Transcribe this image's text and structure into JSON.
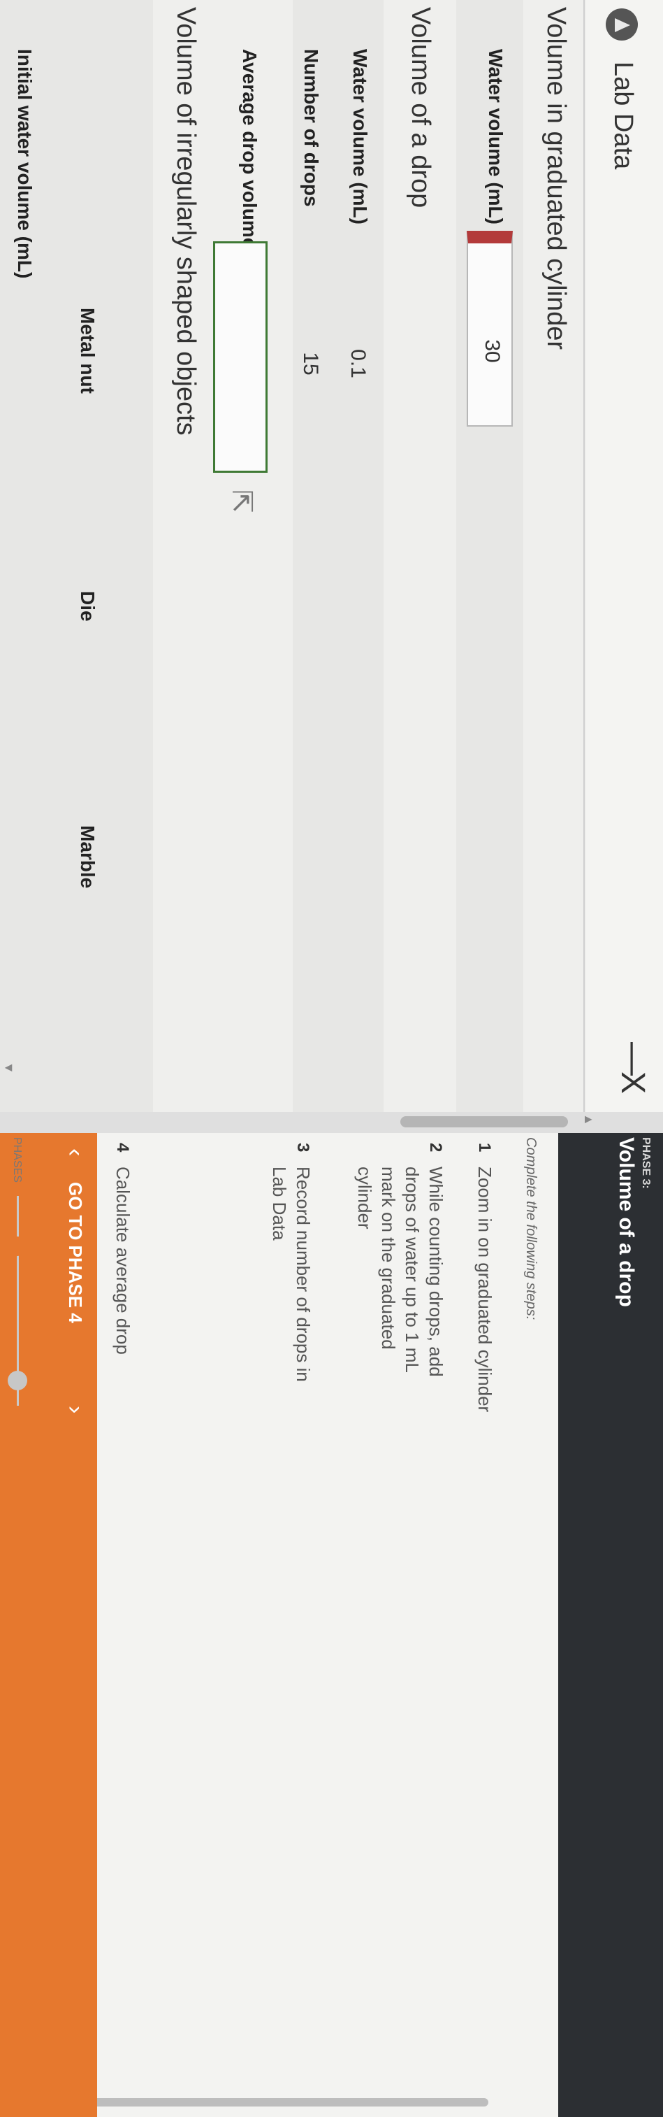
{
  "panel": {
    "title": "Lab Data",
    "minimize_label": "—",
    "close_label": "X"
  },
  "sections": {
    "cylinder": {
      "title": "Volume in graduated cylinder",
      "water_volume_label": "Water volume (mL)",
      "water_volume_value": "30"
    },
    "drop": {
      "title": "Volume of a drop",
      "water_volume_label": "Water volume (mL)",
      "water_volume_value": "0.1",
      "drops_label": "Number of drops",
      "drops_value": "15",
      "average_label": "Average drop volume (mL)",
      "average_value": ""
    },
    "irregular": {
      "title": "Volume of irregularly shaped objects",
      "columns": [
        "Metal nut",
        "Die",
        "Marble"
      ],
      "initial_label": "Initial water volume (mL)"
    }
  },
  "side": {
    "phase_kicker": "PHASE 3:",
    "phase_title": "Volume of a drop",
    "steps_intro": "Complete the following steps:",
    "steps": [
      {
        "num": "1",
        "text": "Zoom in on graduated cylinder"
      },
      {
        "num": "2",
        "text": "While counting drops, add drops of water up to 1 mL mark on the graduated cylinder"
      },
      {
        "num": "3",
        "text": "Record number of drops in Lab Data"
      },
      {
        "num": "4",
        "text": "Calculate average drop"
      }
    ],
    "next_label": "GO TO PHASE 4",
    "prev_icon": "‹",
    "next_icon": "›",
    "phases_label": "PHASES"
  },
  "colors": {
    "accent": "#e6782e",
    "header_dark": "#2c2f33",
    "active_input_border": "#3f7a35",
    "error_marker": "#b33a3a"
  }
}
